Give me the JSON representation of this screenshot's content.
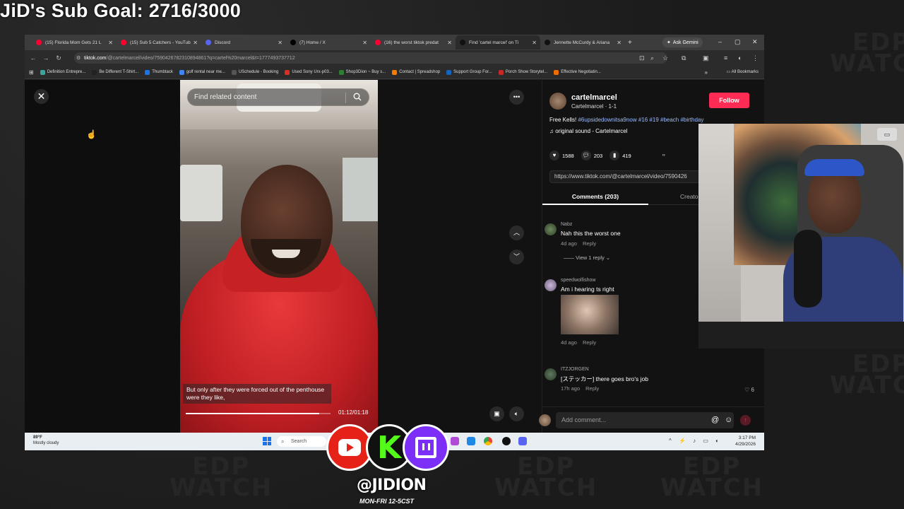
{
  "overlay": {
    "goal_text": "JiD's Sub Goal: 2716/3000",
    "handle": "@JIDION",
    "schedule": "MON-FRI 12-5CST",
    "bg_watermark_line1": "EDP",
    "bg_watermark_line2": "WATCH"
  },
  "browser": {
    "tabs": [
      {
        "label": "(15) Florida Mom Gets 21 L",
        "icon": "youtube-icon",
        "color": "#ff0033",
        "active": false
      },
      {
        "label": "(15) Sub 5 Catchers - YouTub",
        "icon": "youtube-icon",
        "color": "#ff0033",
        "active": false
      },
      {
        "label": "Discord",
        "icon": "discord-icon",
        "color": "#5865f2",
        "active": false
      },
      {
        "label": "(7) Home / X",
        "icon": "x-icon",
        "color": "#000000",
        "active": false
      },
      {
        "label": "(16) the worst tiktok predat",
        "icon": "youtube-icon",
        "color": "#ff0033",
        "active": false
      },
      {
        "label": "Find 'cartel marcel' on Ti",
        "icon": "tiktok-icon",
        "color": "#111111",
        "active": true
      },
      {
        "label": "Jennette McCurdy & Ariana",
        "icon": "tiktok-icon",
        "color": "#111111",
        "active": false
      }
    ],
    "ask_gemini": "Ask Gemini",
    "url_host": "tiktok.com",
    "url_rest": "/@cartelmarcel/video/7590426782310894861?q=cartel%20marcel&t=1777493737712",
    "bookmarks": [
      {
        "label": "Definition Entrepre...",
        "color": "#3aa39a"
      },
      {
        "label": "Be Different T-Shirt...",
        "color": "#222222"
      },
      {
        "label": "Thumbtack",
        "color": "#1a73e8"
      },
      {
        "label": "golf rental near me...",
        "color": "#4285f4"
      },
      {
        "label": "USchedule - Booking",
        "color": "#555555"
      },
      {
        "label": "Used Sony Urx-p03...",
        "color": "#d93025"
      },
      {
        "label": "Shop3Dion ~ Buy s...",
        "color": "#2e7d32"
      },
      {
        "label": "Contact | Spreadshop",
        "color": "#f57c00"
      },
      {
        "label": "Support Group For...",
        "color": "#1565c0"
      },
      {
        "label": "Porch Show Storytel...",
        "color": "#c62828"
      },
      {
        "label": "Effective Negotiatin...",
        "color": "#ef6c00"
      }
    ],
    "all_bookmarks": "All Bookmarks"
  },
  "video": {
    "search_placeholder": "Find related content",
    "caption": "But only after they were forced out of the penthouse were they like,",
    "timecode": "01:12/01:18",
    "progress_fraction": 0.92
  },
  "post": {
    "author_name": "cartelmarcel",
    "author_sub": "Cartelmarcel · 1-1",
    "follow_label": "Follow",
    "desc_text": "Free Kells! ",
    "desc_tags": "#6upsidedownitsa9now #16 #19 #beach #birthday",
    "sound": "original sound - Cartelmarcel",
    "likes": "1588",
    "comments": "203",
    "saves": "419",
    "share_url": "https://www.tiktok.com/@cartelmarcel/video/7590426",
    "tab_comments": "Comments (203)",
    "tab_creator": "Creato"
  },
  "comments": [
    {
      "user": "Nabz",
      "text": "Nah this the worst one",
      "age": "4d ago",
      "reply": "Reply",
      "replies": "View 1 reply",
      "likes": ""
    },
    {
      "user": "speedwolfishow",
      "text": "Am i hearing ts right",
      "age": "4d ago",
      "reply": "Reply",
      "replies": "",
      "likes": ""
    },
    {
      "user": "ITZJORGEN",
      "text": "[ステッカー] there goes bro's job",
      "age": "17h ago",
      "reply": "Reply",
      "replies": "",
      "likes": "6"
    }
  ],
  "comment_input": {
    "placeholder": "Add comment..."
  },
  "taskbar": {
    "temp": "89°F",
    "weather": "Mostly cloudy",
    "search": "Search",
    "time": "3:17 PM",
    "date": "4/29/2026"
  }
}
